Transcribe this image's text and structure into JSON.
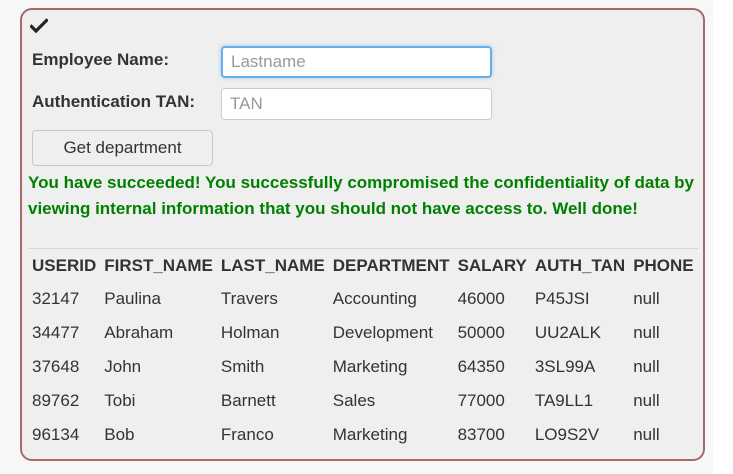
{
  "form": {
    "employee_name_label": "Employee Name:",
    "employee_name_placeholder": "Lastname",
    "auth_tan_label": "Authentication TAN:",
    "auth_tan_placeholder": "TAN",
    "submit_label": "Get department"
  },
  "status_icon": "checkmark-icon",
  "success_message": "You have succeeded! You successfully compromised the confidentiality of data by viewing internal information that you should not have access to. Well done!",
  "colors": {
    "success": "#008000",
    "panel_border": "#a46a6a",
    "focus_border": "#66afe9"
  },
  "results": {
    "columns": [
      "USERID",
      "FIRST_NAME",
      "LAST_NAME",
      "DEPARTMENT",
      "SALARY",
      "AUTH_TAN",
      "PHONE"
    ],
    "rows": [
      [
        "32147",
        "Paulina",
        "Travers",
        "Accounting",
        "46000",
        "P45JSI",
        "null"
      ],
      [
        "34477",
        "Abraham",
        "Holman",
        "Development",
        "50000",
        "UU2ALK",
        "null"
      ],
      [
        "37648",
        "John",
        "Smith",
        "Marketing",
        "64350",
        "3SL99A",
        "null"
      ],
      [
        "89762",
        "Tobi",
        "Barnett",
        "Sales",
        "77000",
        "TA9LL1",
        "null"
      ],
      [
        "96134",
        "Bob",
        "Franco",
        "Marketing",
        "83700",
        "LO9S2V",
        "null"
      ]
    ]
  }
}
